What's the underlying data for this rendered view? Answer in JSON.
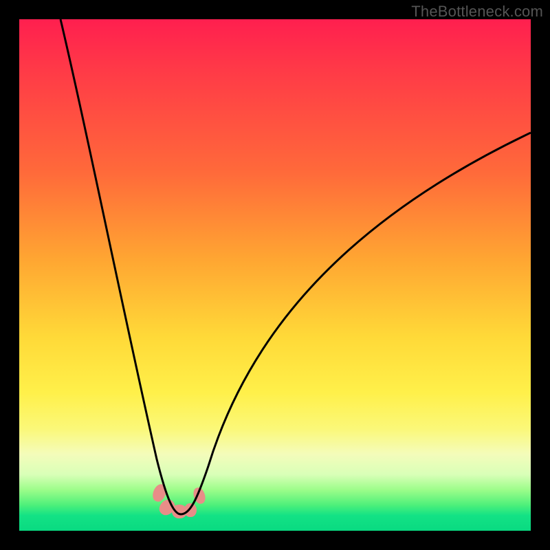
{
  "watermark": "TheBottleneck.com",
  "colors": {
    "frame": "#000000",
    "stroke": "#000000",
    "blob": "#e88d88",
    "gradient_stops": [
      {
        "pos": 0.0,
        "hex": "#ff1f4f"
      },
      {
        "pos": 0.1,
        "hex": "#ff3a47"
      },
      {
        "pos": 0.3,
        "hex": "#ff6a3a"
      },
      {
        "pos": 0.47,
        "hex": "#ffa632"
      },
      {
        "pos": 0.62,
        "hex": "#ffd938"
      },
      {
        "pos": 0.73,
        "hex": "#fff04a"
      },
      {
        "pos": 0.8,
        "hex": "#fbf878"
      },
      {
        "pos": 0.85,
        "hex": "#f4fcba"
      },
      {
        "pos": 0.89,
        "hex": "#d9ffb8"
      },
      {
        "pos": 0.92,
        "hex": "#9cfd8a"
      },
      {
        "pos": 0.95,
        "hex": "#4df07a"
      },
      {
        "pos": 0.97,
        "hex": "#13e285"
      },
      {
        "pos": 1.0,
        "hex": "#09da81"
      }
    ]
  },
  "chart_data": {
    "type": "line",
    "title": "",
    "xlabel": "",
    "ylabel": "",
    "xlim": [
      0,
      100
    ],
    "ylim": [
      0,
      100
    ],
    "note": "Axes unlabeled; values read as percent of plot width/height with (0,0) at bottom-left.",
    "series": [
      {
        "name": "bottleneck-curve",
        "x": [
          8,
          12,
          16,
          20,
          23,
          26,
          28,
          29.5,
          31,
          33,
          35,
          38,
          42,
          48,
          56,
          66,
          78,
          90,
          100
        ],
        "y": [
          100,
          82,
          64,
          46,
          30,
          17,
          8,
          4,
          3,
          4,
          6,
          10,
          18,
          29,
          42,
          55,
          66,
          73,
          78
        ]
      }
    ],
    "markers": [
      {
        "name": "trough-blob-left",
        "x": 27.5,
        "y": 7.0
      },
      {
        "name": "trough-blob-mid1",
        "x": 29.0,
        "y": 4.0
      },
      {
        "name": "trough-blob-mid2",
        "x": 31.0,
        "y": 3.5
      },
      {
        "name": "trough-blob-right",
        "x": 34.0,
        "y": 6.5
      }
    ]
  }
}
